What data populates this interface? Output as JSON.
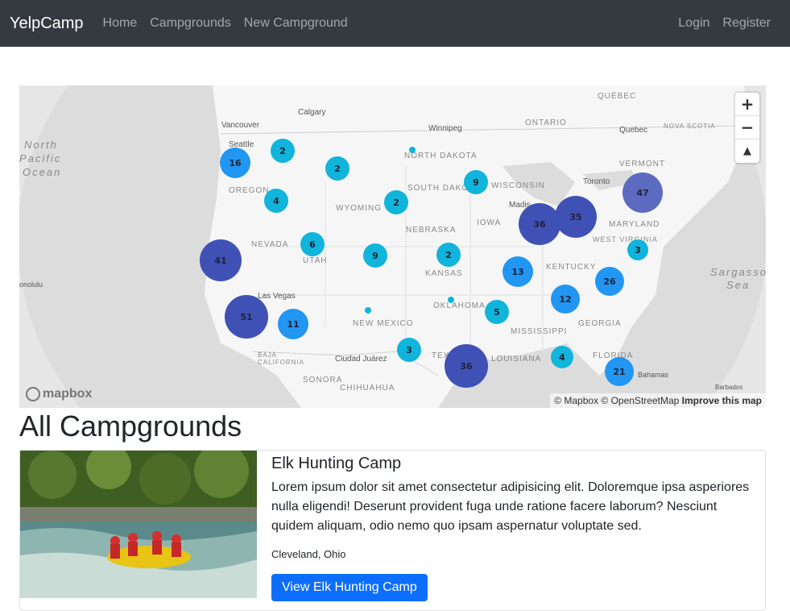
{
  "navbar": {
    "brand": "YelpCamp",
    "links": [
      "Home",
      "Campgrounds",
      "New Campground"
    ],
    "right_links": [
      "Login",
      "Register"
    ]
  },
  "map": {
    "zoom_in": "+",
    "zoom_out": "−",
    "compass": "▲",
    "attribution": "© Mapbox © OpenStreetMap",
    "improve": "Improve this map",
    "logo": "mapbox",
    "clusters": [
      "16",
      "2",
      "2",
      "2",
      "4",
      "9",
      "47",
      "36",
      "35",
      "41",
      "6",
      "9",
      "2",
      "3",
      "13",
      "26",
      "12",
      "5",
      "51",
      "11",
      "3",
      "36",
      "4",
      "21"
    ],
    "labels": {
      "ocean_north": "North",
      "ocean_pacific": "Pacific",
      "ocean_ocean": "Ocean",
      "sargasso": "Sargasso",
      "sea": "Sea",
      "calgary": "Calgary",
      "vancouver": "Vancouver",
      "seattle": "Seattle",
      "winnipeg": "Winnipeg",
      "ontario": "ONTARIO",
      "quebec_region": "QUÉBEC",
      "quebec": "Quebec",
      "nova_scotia": "NOVA SCOTIA",
      "oregon": "OREGON",
      "north_dakota": "NORTH DAKOTA",
      "south_dakota": "SOUTH DAKOTA",
      "wyoming": "WYOMING",
      "wisconsin": "WISCONSIN",
      "toronto": "Toronto",
      "vermont": "VERMONT",
      "nebraska": "NEBRASKA",
      "iowa": "IOWA",
      "nevada": "NEVADA",
      "utah": "UTAH",
      "kansas": "KANSAS",
      "kentucky": "KENTUCKY",
      "maryland": "MARYLAND",
      "west_virginia": "WEST VIRGINIA",
      "honolulu": "onolulu",
      "las_vegas": "Las Vegas",
      "oklahoma": "OKLAHOMA",
      "new_mexico": "NEW MEXICO",
      "mississippi": "MISSISSIPPI",
      "georgia": "GEORGIA",
      "ciudad_juarez": "Ciudad Juárez",
      "louisiana": "LOUISIANA",
      "texas": "TEX",
      "florida": "FLORIDA",
      "bahamas": "Bahamas",
      "baja": "BAJA CALIFORNIA",
      "sonora": "SONORA",
      "chihuahua": "CHIHUAHUA",
      "barbados": "Barbados",
      "madison": "Madis"
    }
  },
  "page_title": "All Campgrounds",
  "campground": {
    "title": "Elk Hunting Camp",
    "description": "Lorem ipsum dolor sit amet consectetur adipisicing elit. Doloremque ipsa asperiores nulla eligendi! Deserunt provident fuga unde ratione facere laborum? Nesciunt quidem aliquam, odio nemo quo ipsam aspernatur voluptate sed.",
    "location": "Cleveland, Ohio",
    "button": "View Elk Hunting Camp"
  },
  "colors": {
    "navbar": "#343a40",
    "cluster_small": "#11b4da",
    "cluster_medium": "#2196f3",
    "cluster_large": "#3f51b5",
    "primary": "#0d6efd"
  }
}
